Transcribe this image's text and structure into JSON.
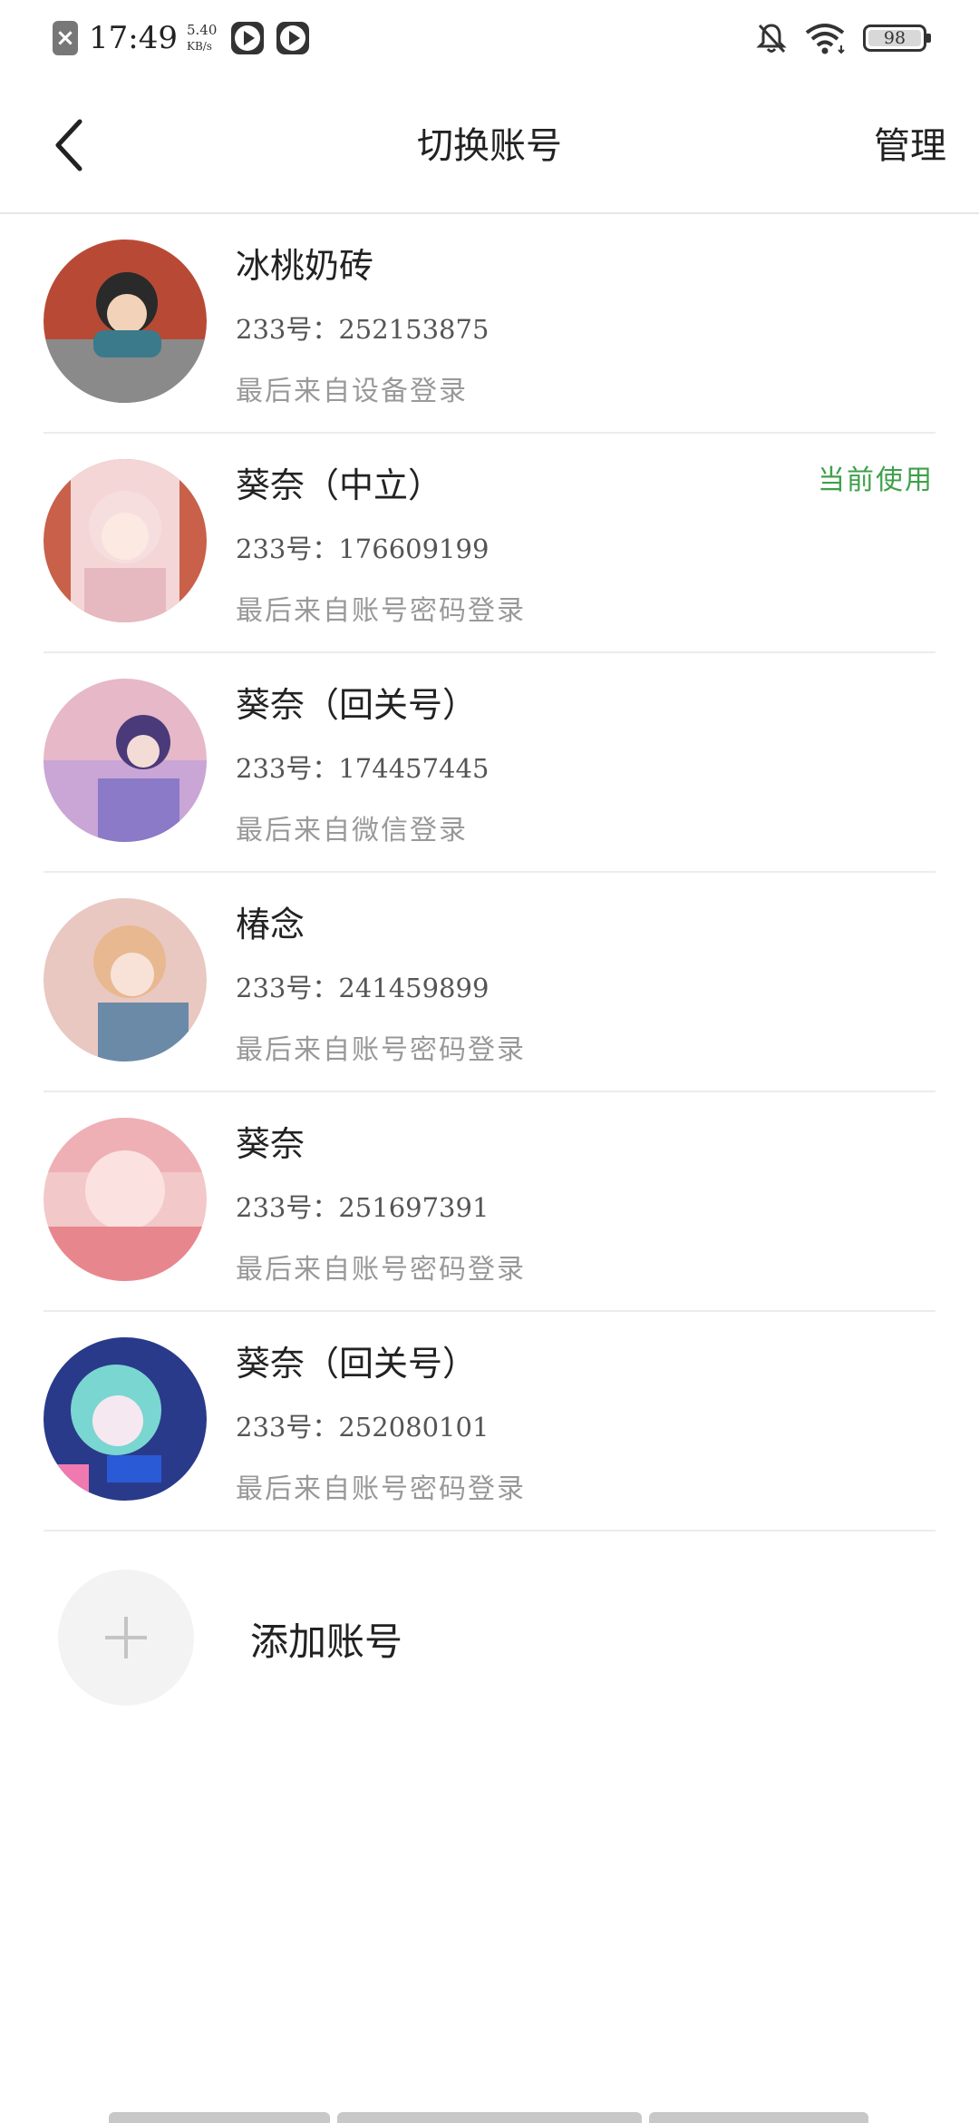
{
  "status_bar": {
    "time": "17:49",
    "speed_value": "5.40",
    "speed_unit": "KB/s",
    "battery": "98",
    "icons": [
      "close-notification-icon",
      "play-app-icon",
      "play-app-icon",
      "mute-bell-icon",
      "wifi-icon",
      "battery-icon"
    ]
  },
  "header": {
    "back_icon": "chevron-left-icon",
    "title": "切换账号",
    "manage_label": "管理"
  },
  "accounts": [
    {
      "name": "冰桃奶砖",
      "id_label": "233号：252153875",
      "login_source": "最后来自设备登录",
      "current": "",
      "avatar_color": "#c0503a"
    },
    {
      "name": "葵奈（中立）",
      "id_label": "233号：176609199",
      "login_source": "最后来自账号密码登录",
      "current": "当前使用",
      "avatar_color": "#e8b8b8"
    },
    {
      "name": "葵奈（回关号）",
      "id_label": "233号：174457445",
      "login_source": "最后来自微信登录",
      "current": "",
      "avatar_color": "#9a85c8"
    },
    {
      "name": "椿念",
      "id_label": "233号：241459899",
      "login_source": "最后来自账号密码登录",
      "current": "",
      "avatar_color": "#d6a9a0"
    },
    {
      "name": "葵奈",
      "id_label": "233号：251697391",
      "login_source": "最后来自账号密码登录",
      "current": "",
      "avatar_color": "#ee9aa0"
    },
    {
      "name": "葵奈（回关号）",
      "id_label": "233号：252080101",
      "login_source": "最后来自账号密码登录",
      "current": "",
      "avatar_color": "#4a6fc8"
    }
  ],
  "add_account": {
    "icon": "plus-icon",
    "label": "添加账号"
  },
  "colors": {
    "accent_green": "#3ea04a",
    "divider": "#ececec",
    "secondary_text": "#999999"
  }
}
